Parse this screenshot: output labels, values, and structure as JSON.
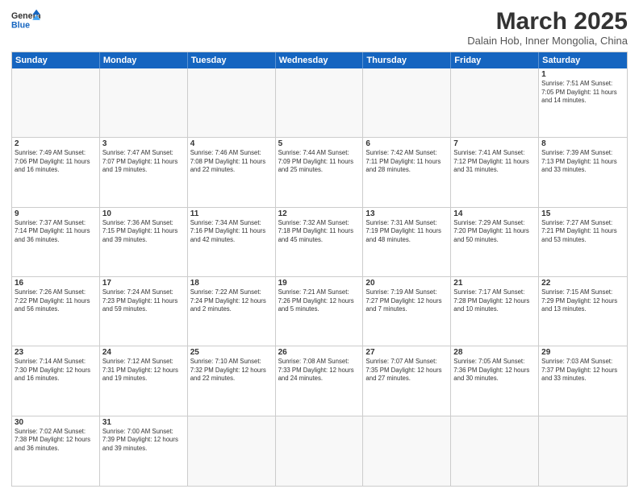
{
  "header": {
    "logo_general": "General",
    "logo_blue": "Blue",
    "month_title": "March 2025",
    "subtitle": "Dalain Hob, Inner Mongolia, China"
  },
  "weekdays": [
    "Sunday",
    "Monday",
    "Tuesday",
    "Wednesday",
    "Thursday",
    "Friday",
    "Saturday"
  ],
  "weeks": [
    [
      {
        "day": "",
        "info": ""
      },
      {
        "day": "",
        "info": ""
      },
      {
        "day": "",
        "info": ""
      },
      {
        "day": "",
        "info": ""
      },
      {
        "day": "",
        "info": ""
      },
      {
        "day": "",
        "info": ""
      },
      {
        "day": "1",
        "info": "Sunrise: 7:51 AM\nSunset: 7:05 PM\nDaylight: 11 hours\nand 14 minutes."
      }
    ],
    [
      {
        "day": "2",
        "info": "Sunrise: 7:49 AM\nSunset: 7:06 PM\nDaylight: 11 hours\nand 16 minutes."
      },
      {
        "day": "3",
        "info": "Sunrise: 7:47 AM\nSunset: 7:07 PM\nDaylight: 11 hours\nand 19 minutes."
      },
      {
        "day": "4",
        "info": "Sunrise: 7:46 AM\nSunset: 7:08 PM\nDaylight: 11 hours\nand 22 minutes."
      },
      {
        "day": "5",
        "info": "Sunrise: 7:44 AM\nSunset: 7:09 PM\nDaylight: 11 hours\nand 25 minutes."
      },
      {
        "day": "6",
        "info": "Sunrise: 7:42 AM\nSunset: 7:11 PM\nDaylight: 11 hours\nand 28 minutes."
      },
      {
        "day": "7",
        "info": "Sunrise: 7:41 AM\nSunset: 7:12 PM\nDaylight: 11 hours\nand 31 minutes."
      },
      {
        "day": "8",
        "info": "Sunrise: 7:39 AM\nSunset: 7:13 PM\nDaylight: 11 hours\nand 33 minutes."
      }
    ],
    [
      {
        "day": "9",
        "info": "Sunrise: 7:37 AM\nSunset: 7:14 PM\nDaylight: 11 hours\nand 36 minutes."
      },
      {
        "day": "10",
        "info": "Sunrise: 7:36 AM\nSunset: 7:15 PM\nDaylight: 11 hours\nand 39 minutes."
      },
      {
        "day": "11",
        "info": "Sunrise: 7:34 AM\nSunset: 7:16 PM\nDaylight: 11 hours\nand 42 minutes."
      },
      {
        "day": "12",
        "info": "Sunrise: 7:32 AM\nSunset: 7:18 PM\nDaylight: 11 hours\nand 45 minutes."
      },
      {
        "day": "13",
        "info": "Sunrise: 7:31 AM\nSunset: 7:19 PM\nDaylight: 11 hours\nand 48 minutes."
      },
      {
        "day": "14",
        "info": "Sunrise: 7:29 AM\nSunset: 7:20 PM\nDaylight: 11 hours\nand 50 minutes."
      },
      {
        "day": "15",
        "info": "Sunrise: 7:27 AM\nSunset: 7:21 PM\nDaylight: 11 hours\nand 53 minutes."
      }
    ],
    [
      {
        "day": "16",
        "info": "Sunrise: 7:26 AM\nSunset: 7:22 PM\nDaylight: 11 hours\nand 56 minutes."
      },
      {
        "day": "17",
        "info": "Sunrise: 7:24 AM\nSunset: 7:23 PM\nDaylight: 11 hours\nand 59 minutes."
      },
      {
        "day": "18",
        "info": "Sunrise: 7:22 AM\nSunset: 7:24 PM\nDaylight: 12 hours\nand 2 minutes."
      },
      {
        "day": "19",
        "info": "Sunrise: 7:21 AM\nSunset: 7:26 PM\nDaylight: 12 hours\nand 5 minutes."
      },
      {
        "day": "20",
        "info": "Sunrise: 7:19 AM\nSunset: 7:27 PM\nDaylight: 12 hours\nand 7 minutes."
      },
      {
        "day": "21",
        "info": "Sunrise: 7:17 AM\nSunset: 7:28 PM\nDaylight: 12 hours\nand 10 minutes."
      },
      {
        "day": "22",
        "info": "Sunrise: 7:15 AM\nSunset: 7:29 PM\nDaylight: 12 hours\nand 13 minutes."
      }
    ],
    [
      {
        "day": "23",
        "info": "Sunrise: 7:14 AM\nSunset: 7:30 PM\nDaylight: 12 hours\nand 16 minutes."
      },
      {
        "day": "24",
        "info": "Sunrise: 7:12 AM\nSunset: 7:31 PM\nDaylight: 12 hours\nand 19 minutes."
      },
      {
        "day": "25",
        "info": "Sunrise: 7:10 AM\nSunset: 7:32 PM\nDaylight: 12 hours\nand 22 minutes."
      },
      {
        "day": "26",
        "info": "Sunrise: 7:08 AM\nSunset: 7:33 PM\nDaylight: 12 hours\nand 24 minutes."
      },
      {
        "day": "27",
        "info": "Sunrise: 7:07 AM\nSunset: 7:35 PM\nDaylight: 12 hours\nand 27 minutes."
      },
      {
        "day": "28",
        "info": "Sunrise: 7:05 AM\nSunset: 7:36 PM\nDaylight: 12 hours\nand 30 minutes."
      },
      {
        "day": "29",
        "info": "Sunrise: 7:03 AM\nSunset: 7:37 PM\nDaylight: 12 hours\nand 33 minutes."
      }
    ],
    [
      {
        "day": "30",
        "info": "Sunrise: 7:02 AM\nSunset: 7:38 PM\nDaylight: 12 hours\nand 36 minutes."
      },
      {
        "day": "31",
        "info": "Sunrise: 7:00 AM\nSunset: 7:39 PM\nDaylight: 12 hours\nand 39 minutes."
      },
      {
        "day": "",
        "info": ""
      },
      {
        "day": "",
        "info": ""
      },
      {
        "day": "",
        "info": ""
      },
      {
        "day": "",
        "info": ""
      },
      {
        "day": "",
        "info": ""
      }
    ]
  ]
}
